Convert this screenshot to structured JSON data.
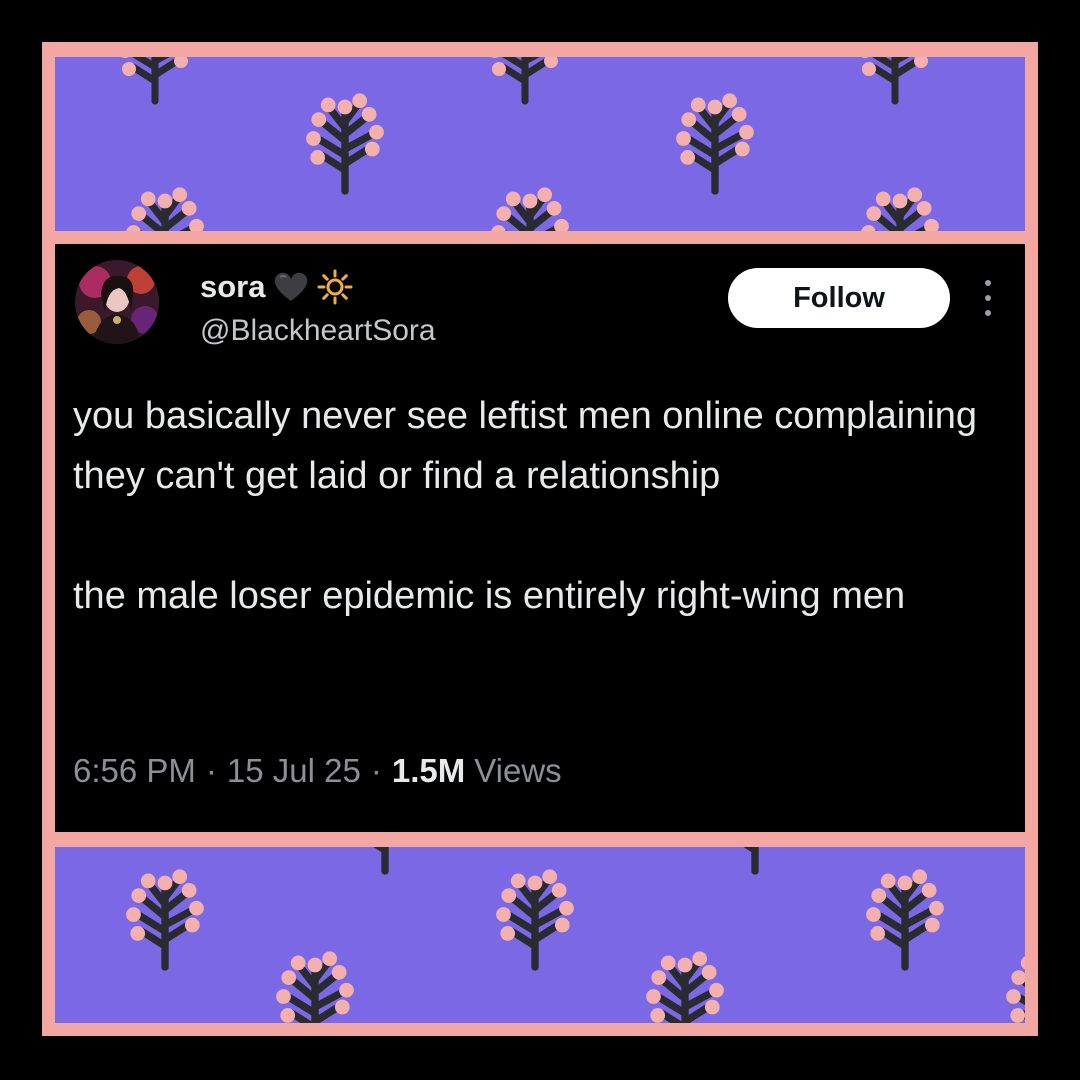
{
  "colors": {
    "background": "#000000",
    "frame": "#f2a7a3",
    "pattern_background": "#7b68e4",
    "pattern_stem": "#2a2a33",
    "pattern_bud": "#f4b0ae",
    "text_primary": "#e7e9ea",
    "text_secondary": "#8b9096",
    "follow_button_bg": "#ffffff"
  },
  "tweet": {
    "avatar_icon": "profile-photo",
    "display_name": "sora",
    "name_emojis": [
      "black-heart-icon",
      "sun-icon"
    ],
    "handle": "@BlackheartSora",
    "follow_label": "Follow",
    "more_icon": "more-vertical-icon",
    "text_paragraphs": [
      "you basically never see leftist men online complaining they can't get laid or find a relationship",
      "the male loser epidemic is entirely right-wing men"
    ],
    "time": "6:56 PM",
    "date": "15 Jul 25",
    "views_count": "1.5M",
    "views_label": "Views",
    "separator": "·"
  }
}
